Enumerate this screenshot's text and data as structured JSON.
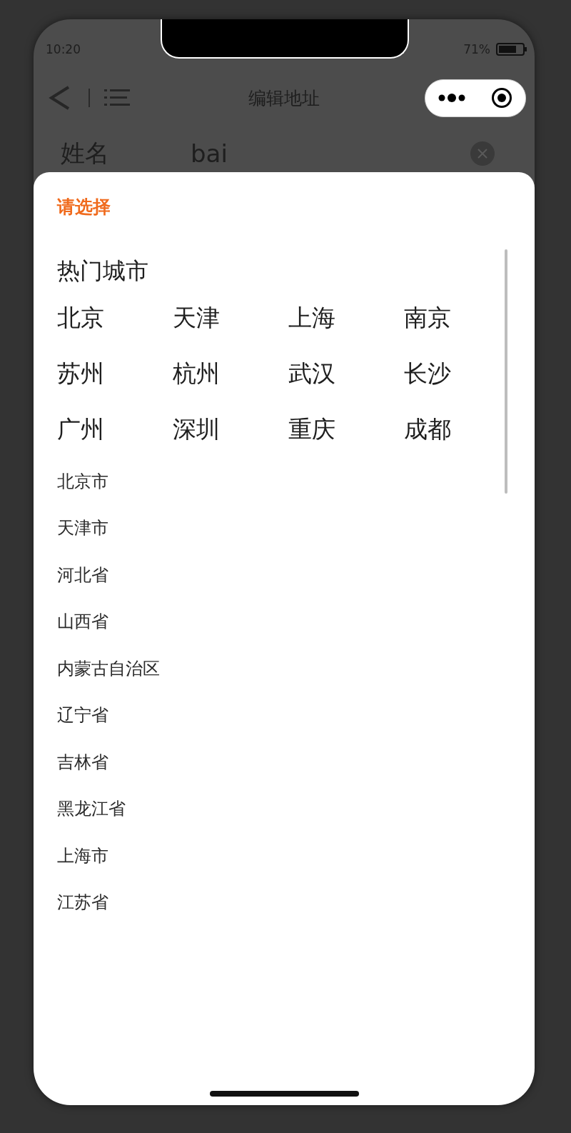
{
  "status_bar": {
    "time": "10:20",
    "battery": "71%"
  },
  "nav_bar": {
    "title": "编辑地址"
  },
  "name_field": {
    "label": "姓名",
    "value": "bai"
  },
  "picker_sheet": {
    "title": "请选择",
    "hot_title": "热门城市",
    "hot_cities": [
      "北京",
      "天津",
      "上海",
      "南京",
      "苏州",
      "杭州",
      "武汉",
      "长沙",
      "广州",
      "深圳",
      "重庆",
      "成都"
    ],
    "regions": [
      "北京市",
      "天津市",
      "河北省",
      "山西省",
      "内蒙古自治区",
      "辽宁省",
      "吉林省",
      "黑龙江省",
      "上海市",
      "江苏省"
    ]
  }
}
